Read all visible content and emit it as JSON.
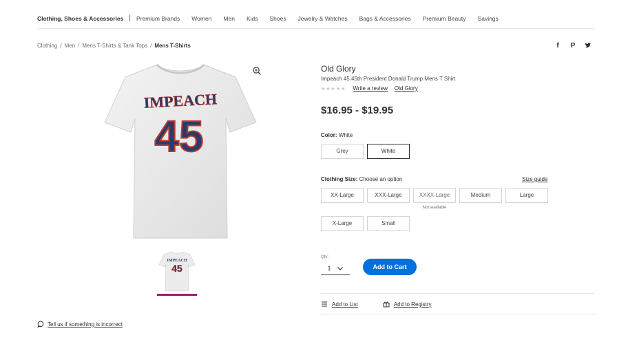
{
  "nav": {
    "primary": "Clothing, Shoes & Accessories",
    "separator": "|",
    "items": [
      "Premium Brands",
      "Women",
      "Men",
      "Kids",
      "Shoes",
      "Jewelry & Watches",
      "Bags & Accessories",
      "Premium Beauty",
      "Savings"
    ]
  },
  "breadcrumb": [
    "Clothing",
    "/",
    "Men",
    "/",
    "Mens T-Shirts & Tank Tops",
    "/",
    "Mens T-Shirts"
  ],
  "share": {
    "facebook": "f",
    "pinterest": "P",
    "twitter": "y"
  },
  "product": {
    "brand": "Old Glory",
    "title": "Impeach 45 45th President Donald Trump Mens T Shirt",
    "stars": "★★★★★",
    "write_review": "Write a review",
    "brand_link": "Old Glory",
    "price": "$16.95 - $19.95",
    "shirt_word": "IMPEACH",
    "shirt_number": "45"
  },
  "color": {
    "label": "Color:",
    "value": "White",
    "options": [
      "Grey",
      "White"
    ],
    "selected": "White"
  },
  "size": {
    "label": "Clothing Size:",
    "value": "Choose an option",
    "guide": "Size guide",
    "options": [
      "XX-Large",
      "XXX-Large",
      "XXXX-Large",
      "Medium",
      "Large",
      "X-Large",
      "Small"
    ],
    "unavailable_note": "Not available"
  },
  "qty": {
    "label": "Qty:",
    "value": "1"
  },
  "cart": {
    "add_label": "Add to Cart"
  },
  "actions": {
    "list": "Add to List",
    "registry": "Add to Registry"
  },
  "report": {
    "label": "Tell us if something is incorrect"
  },
  "colors": {
    "accent": "#0071dc",
    "thumb_indicator": "#a01a7d",
    "shirt_red": "#c0392b",
    "shirt_navy": "#2b3a6b"
  }
}
